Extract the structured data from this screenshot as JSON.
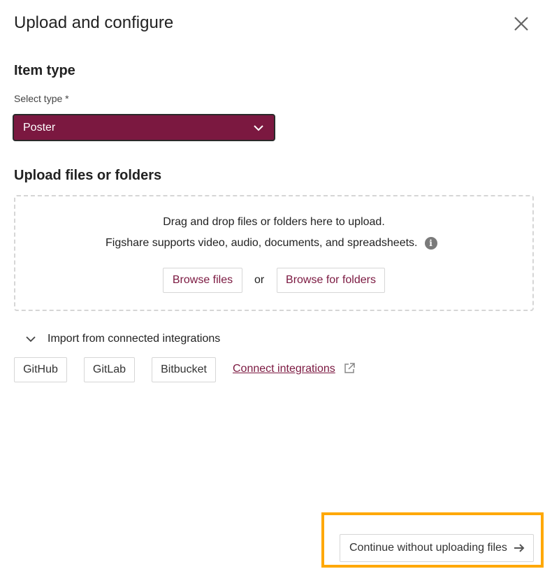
{
  "dialog": {
    "title": "Upload and configure",
    "close_icon": "close-icon"
  },
  "item_type": {
    "heading": "Item type",
    "select_label": "Select type *",
    "selected_value": "Poster",
    "accent_color": "#7b1840"
  },
  "upload": {
    "heading": "Upload files or folders",
    "drop_text": "Drag and drop files or folders here to upload.",
    "supports_text": "Figshare supports video, audio, documents, and spreadsheets.",
    "info_icon": "i",
    "browse_files_label": "Browse files",
    "or_text": "or",
    "browse_folders_label": "Browse for folders"
  },
  "integrations": {
    "toggle_label": "Import from connected integrations",
    "items": [
      {
        "label": "GitHub"
      },
      {
        "label": "GitLab"
      },
      {
        "label": "Bitbucket"
      }
    ],
    "connect_label": "Connect integrations"
  },
  "footer": {
    "continue_label": "Continue without uploading files",
    "highlight_color": "#ffa800"
  }
}
